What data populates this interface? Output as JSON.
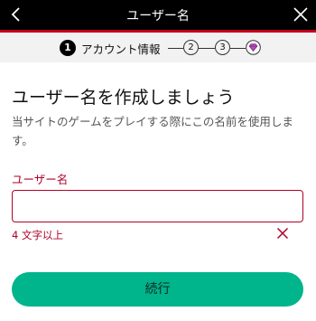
{
  "header": {
    "title": "ユーザー名",
    "back_icon": "chevron-left-icon",
    "close_icon": "close-icon"
  },
  "stepper": {
    "step1_number": "1",
    "step1_label": "アカウント情報",
    "step2_number": "2",
    "step3_number": "3",
    "final_icon": "diamond-icon"
  },
  "main": {
    "heading": "ユーザー名を作成しましょう",
    "description": "当サイトのゲームをプレイする際にこの名前を使用します。"
  },
  "username_field": {
    "label": "ユーザー名",
    "value": "",
    "error": "4 文字以上",
    "error_icon": "x-icon"
  },
  "continue_button": {
    "label": "続行"
  },
  "colors": {
    "header_bg": "#000000",
    "accent_red": "#c3001a",
    "error_red": "#b0002a",
    "button_green": "#00b48c",
    "stepper_bg": "#f2f2f2"
  }
}
